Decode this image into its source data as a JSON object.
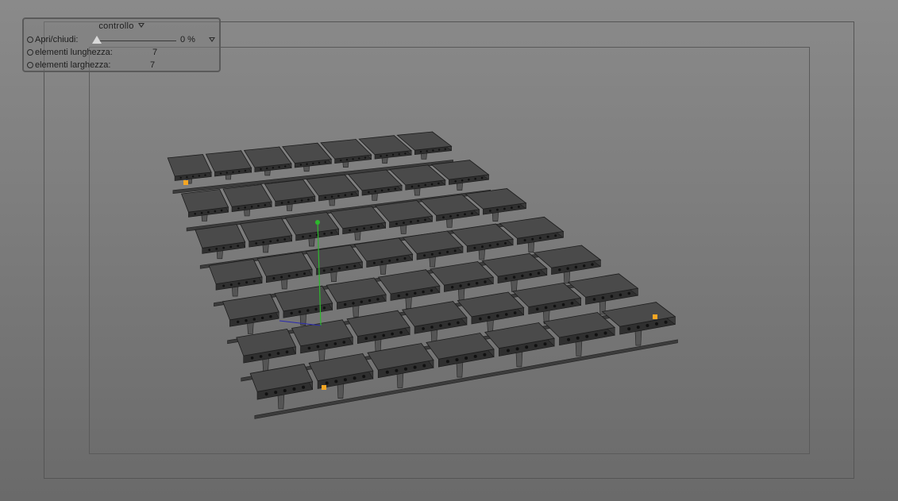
{
  "hud": {
    "title": "controllo",
    "open_close_label": "Apri/chiudi:",
    "open_close_value": "0 %",
    "open_close_fraction": 0,
    "length_label": "elementi lunghezza:",
    "length_value": "7",
    "width_label": "elementi larghezza:",
    "width_value": "7"
  },
  "colors": {
    "background": "#7f7f7f",
    "slab_top": "#4a4a4a",
    "handle": "#f5a623",
    "axis_y": "#2db82d",
    "axis_x": "#2a2ab0"
  }
}
